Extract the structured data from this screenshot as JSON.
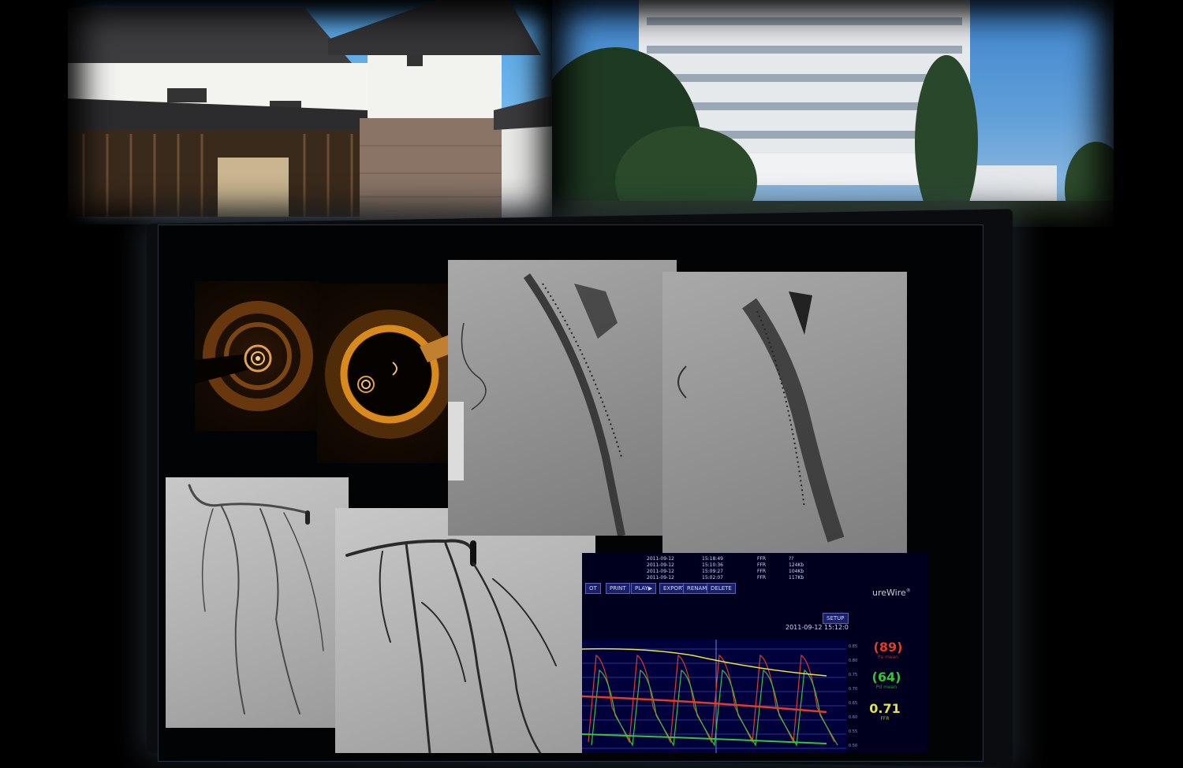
{
  "photos": {
    "castle_alt": "Japanese castle gate",
    "hospital_alt": "Hospital building"
  },
  "monitor": {
    "brand_text": "ureWire",
    "brand_mark": "®",
    "timestamp": "2011-09-12 15:12:0",
    "buttons": [
      "OT",
      "PRINT",
      "PLAY▶",
      "EXPORT",
      "RENAME",
      "DELETE"
    ],
    "setup_label": "SETUP",
    "list_rows": [
      {
        "date": "2011-09-12",
        "time": "15:18:49",
        "type": "FFR",
        "size": "??"
      },
      {
        "date": "2011-09-12",
        "time": "15:10:36",
        "type": "FFR",
        "size": "124Kb"
      },
      {
        "date": "2011-09-12",
        "time": "15:09:27",
        "type": "FFR",
        "size": "104Kb"
      },
      {
        "date": "2011-09-12",
        "time": "15:02:07",
        "type": "FFR",
        "size": "117Kb"
      }
    ],
    "scale_ticks": [
      "0.85",
      "0.80",
      "0.75",
      "0.70",
      "0.65",
      "0.60",
      "0.55",
      "0.50"
    ],
    "pa_mean": {
      "value": "(89)",
      "label": "Pa mean",
      "color": "#e23b2a"
    },
    "pd_mean": {
      "value": "(64)",
      "label": "Pd mean",
      "color": "#35c43a"
    },
    "ffr": {
      "value": "0.71",
      "label": "FFR",
      "color": "#e8e33a"
    }
  },
  "colors": {
    "oct_ring": "#d98a1c",
    "pa_line": "#e23b2a",
    "pd_line": "#35c43a",
    "ffr_line": "#e8e33a"
  }
}
